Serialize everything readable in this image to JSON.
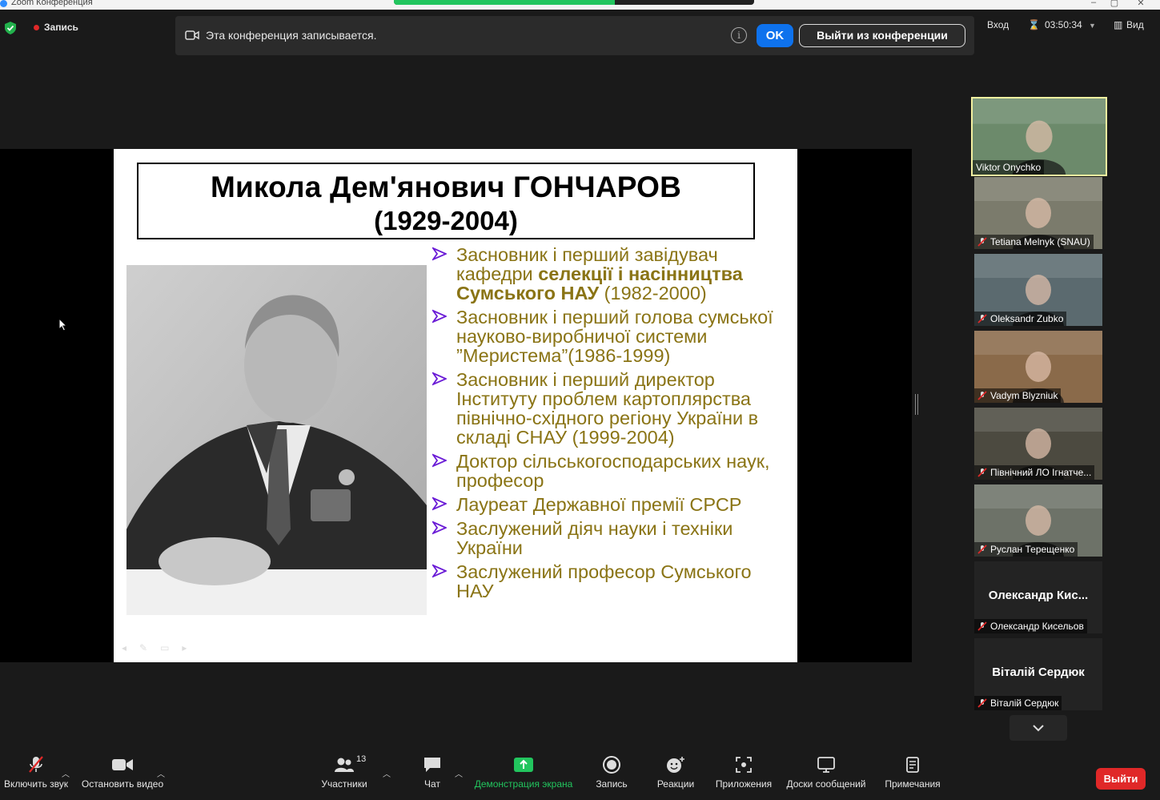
{
  "window": {
    "title": "Zoom Конференция"
  },
  "top_bar": {
    "recording_label": "Запись",
    "notification": "Эта конференция записывается.",
    "ok_label": "OK",
    "leave_conf_label": "Выйти из конференции",
    "signin_label": "Вход",
    "timer": "03:50:34",
    "view_label": "Вид"
  },
  "slide": {
    "title_name": "Микола Дем'янович ГОНЧАРОВ",
    "title_years": "(1929-2004)",
    "bullets": [
      {
        "pre": "Засновник і перший завідувач кафедри ",
        "bold": "селекції і насінництва Сумського НАУ",
        "post": " (1982-2000)"
      },
      {
        "pre": "Засновник і перший голова сумської науково-виробничої системи ”Меристема”(1986-1999)",
        "bold": "",
        "post": ""
      },
      {
        "pre": "Засновник і перший директор Інституту проблем картоплярства північно-східного регіону України в складі СНАУ (1999-2004)",
        "bold": "",
        "post": ""
      },
      {
        "pre": "Доктор сільськогосподарських наук, професор",
        "bold": "",
        "post": ""
      },
      {
        "pre": "Лауреат Державної премії СРСР",
        "bold": "",
        "post": ""
      },
      {
        "pre": "Заслужений діяч науки і техніки України",
        "bold": "",
        "post": ""
      },
      {
        "pre": "Заслужений професор Сумського НАУ",
        "bold": "",
        "post": ""
      }
    ]
  },
  "participants": [
    {
      "name": "Viktor Onychko",
      "muted": false,
      "bigname": ""
    },
    {
      "name": "Tetiana Melnyk (SNAU)",
      "muted": true,
      "bigname": ""
    },
    {
      "name": "Oleksandr Zubko",
      "muted": true,
      "bigname": ""
    },
    {
      "name": "Vadym Blyzniuk",
      "muted": true,
      "bigname": ""
    },
    {
      "name": "Північний ЛО Ігнатче...",
      "muted": true,
      "bigname": ""
    },
    {
      "name": "Руслан Терещенко",
      "muted": true,
      "bigname": ""
    },
    {
      "name": "Олександр Кисельов",
      "muted": true,
      "bigname": "Олександр  Кис..."
    },
    {
      "name": "Віталій Сердюк",
      "muted": true,
      "bigname": "Віталій Сердюк"
    }
  ],
  "toolbar": {
    "unmute": "Включить звук",
    "video": "Остановить видео",
    "participants": "Участники",
    "participants_count": "13",
    "chat": "Чат",
    "share": "Демонстрация экрана",
    "record": "Запись",
    "reactions": "Реакции",
    "apps": "Приложения",
    "whiteboards": "Доски сообщений",
    "notes": "Примечания",
    "leave": "Выйти"
  },
  "colors": {
    "accent_blue": "#0e72ed",
    "share_green": "#22c55e",
    "leave_red": "#e02828",
    "slide_text": "#8a7415",
    "bullet_arrow": "#6a1bd6"
  }
}
